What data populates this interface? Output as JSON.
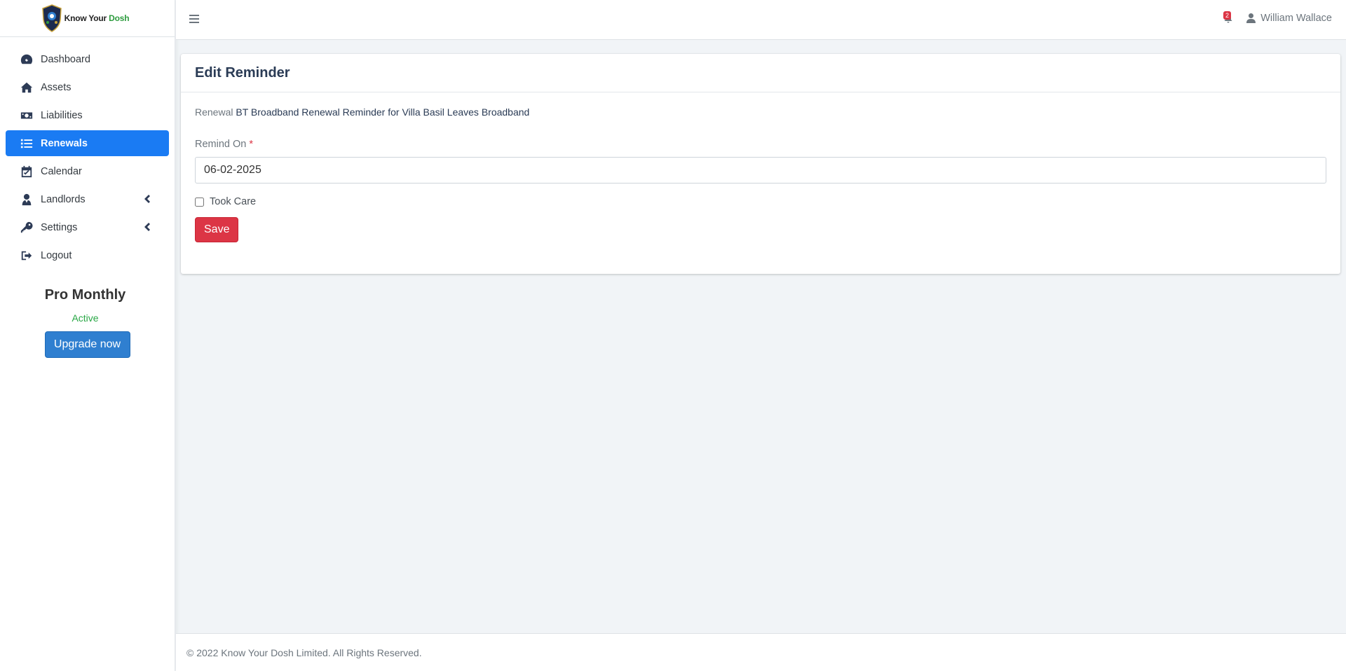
{
  "brand": {
    "name_part1": "Know Your ",
    "name_part2": "Dosh",
    "accent_color": "#2e9c3f"
  },
  "sidebar": {
    "items": [
      {
        "label": "Dashboard",
        "icon": "tachometer-icon"
      },
      {
        "label": "Assets",
        "icon": "home-icon"
      },
      {
        "label": "Liabilities",
        "icon": "money-bill-icon"
      },
      {
        "label": "Renewals",
        "icon": "list-icon",
        "active": true
      },
      {
        "label": "Calendar",
        "icon": "calendar-check-icon"
      },
      {
        "label": "Landlords",
        "icon": "user-tie-icon",
        "has_submenu": true
      },
      {
        "label": "Settings",
        "icon": "key-icon",
        "has_submenu": true
      },
      {
        "label": "Logout",
        "icon": "sign-out-icon"
      }
    ],
    "active_color": "#1a7bf3"
  },
  "plan": {
    "name": "Pro Monthly",
    "status": "Active",
    "upgrade_label": "Upgrade now"
  },
  "topbar": {
    "notification_count": "2",
    "user_name": "William Wallace"
  },
  "card": {
    "title": "Edit Reminder",
    "renewal_prefix": "Renewal",
    "renewal_name": "BT Broadband Renewal Reminder for Villa Basil Leaves Broadband",
    "remind_on_label": "Remind On",
    "required_marker": "*",
    "remind_on_value": "06-02-2025",
    "took_care_label": "Took Care",
    "took_care_checked": false,
    "save_label": "Save"
  },
  "footer": {
    "text": "© 2022 Know Your Dosh Limited. All Rights Reserved."
  }
}
